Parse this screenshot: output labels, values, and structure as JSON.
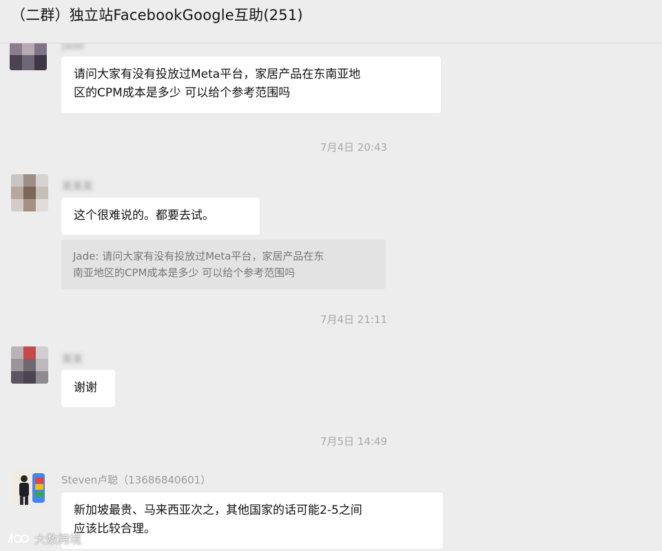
{
  "window": {
    "title": "（二群）独立站FacebookGoogle互助(251)"
  },
  "messages": [
    {
      "sender_name": "Jade",
      "text": "请问大家有没有投放过Meta平台，家居产品在东南亚地区的CPM成本是多少 可以给个参考范围吗"
    },
    {
      "type": "timestamp",
      "text": "7月4日 20:43"
    },
    {
      "sender_name": "",
      "text": "这个很难说的。都要去试。",
      "quote": "Jade: 请问大家有没有投放过Meta平台，家居产品在东南亚地区的CPM成本是多少 可以给个参考范围吗"
    },
    {
      "type": "timestamp",
      "text": "7月4日 21:11"
    },
    {
      "sender_name": "",
      "text": "谢谢"
    },
    {
      "type": "timestamp",
      "text": "7月5日 14:49"
    },
    {
      "sender_name": "Steven卢聪（13686840601）",
      "text": "新加坡最贵、马来西亚次之，其他国家的话可能2-5之间应该比较合理。"
    }
  ],
  "message_lines": {
    "m1_l1": "请问大家有没有投放过Meta平台，家居产品在东南亚地",
    "m1_l2": "区的CPM成本是多少 可以给个参考范围吗",
    "m2": "这个很难说的。都要去试。",
    "q_l1": "Jade: 请问大家有没有投放过Meta平台，家居产品在东",
    "q_l2": "南亚地区的CPM成本是多少 可以给个参考范围吗",
    "m3": "谢谢",
    "m4_l1": "新加坡最贵、马来西亚次之，其他国家的话可能2-5之间",
    "m4_l2": "应该比较合理。"
  },
  "watermark": {
    "text": "大数跨境"
  },
  "colors": {
    "background": "#ededed",
    "bubble": "#ffffff",
    "quote_bg": "#e3e3e3",
    "timestamp": "#a8a8a8"
  }
}
